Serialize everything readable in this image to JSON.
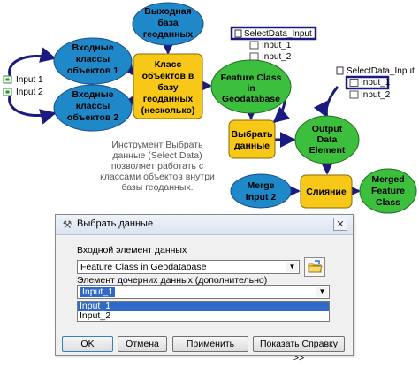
{
  "nodes": {
    "input_1": "Input 1",
    "input_2": "Input 2",
    "class1": [
      "Входные",
      "классы",
      "объектов 1"
    ],
    "class2": [
      "Входные",
      "классы",
      "объектов 2"
    ],
    "gdb": [
      "Выходная",
      "база",
      "геоданных"
    ],
    "tool_classes": [
      "Класс",
      "объектов в",
      "базу",
      "геоданных",
      "(несколько)"
    ],
    "fc_gdb": [
      "Feature Class",
      "in",
      "Geodatabase"
    ],
    "select1": [
      "Выбрать",
      "данные"
    ],
    "out_elem": [
      "Output",
      "Data",
      "Element"
    ],
    "merge_in2": [
      "Merge",
      "Input 2"
    ],
    "merge_tool": "Слияние",
    "merged_fc": [
      "Merged",
      "Feature",
      "Class"
    ],
    "sel_input_a": "SelectData_Input",
    "sel_input_a_items": [
      "Input_1",
      "Input_2"
    ],
    "sel_input_b": "SelectData_Input",
    "sel_input_b_items": [
      "Input_1",
      "Input_2"
    ],
    "description": [
      "Инструмент Выбрать",
      "данные (Select Data)",
      "позволяет работать с",
      "классами объектов внутри",
      "базы геоданных."
    ]
  },
  "colors": {
    "ellipse_blue": "#1e88c8",
    "ellipse_green": "#3cbf3c",
    "tool_yellow": "#f8c818",
    "arrow_navy": "#1a1a80"
  },
  "dialog": {
    "title": "Выбрать данные",
    "input_label": "Входной элемент данных",
    "input_value": "Feature Class in Geodatabase",
    "child_label": "Элемент дочерних данных (дополнительно)",
    "child_value": "Input_1",
    "options": [
      "Input_1",
      "Input_2"
    ],
    "buttons": {
      "ok": "OK",
      "cancel": "Отмена",
      "apply": "Применить",
      "help": "Показать Справку >>"
    }
  }
}
